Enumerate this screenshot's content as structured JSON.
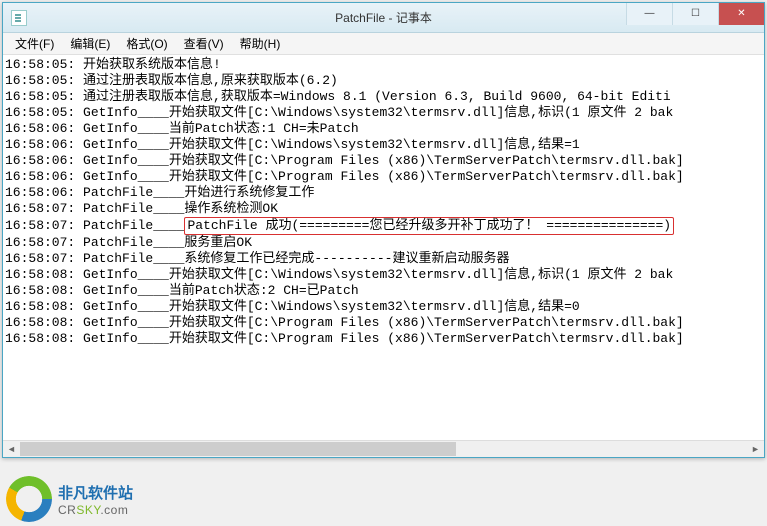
{
  "title": "PatchFile - 记事本",
  "menus": {
    "file": "文件(F)",
    "edit": "编辑(E)",
    "format": "格式(O)",
    "view": "查看(V)",
    "help": "帮助(H)"
  },
  "log_lines": [
    "16:58:05:  开始获取系统版本信息!",
    "16:58:05:  通过注册表取版本信息,原来获取版本(6.2)",
    "16:58:05:  通过注册表取版本信息,获取版本=Windows 8.1 (Version 6.3, Build 9600, 64-bit Editi",
    "16:58:05:  GetInfo____开始获取文件[C:\\Windows\\system32\\termsrv.dll]信息,标识(1 原文件 2 bak",
    "16:58:06:  GetInfo____当前Patch状态:1 CH=未Patch",
    "16:58:06:  GetInfo____开始获取文件[C:\\Windows\\system32\\termsrv.dll]信息,结果=1",
    "16:58:06:  GetInfo____开始获取文件[C:\\Program Files (x86)\\TermServerPatch\\termsrv.dll.bak]",
    "16:58:06:  GetInfo____开始获取文件[C:\\Program Files (x86)\\TermServerPatch\\termsrv.dll.bak]",
    "16:58:06:  PatchFile____开始进行系统修复工作",
    "16:58:07:  PatchFile____操作系统检测OK",
    "16:58:07:  PatchFile____服务重启OK",
    "16:58:07:  PatchFile____系统修复工作已经完成----------建议重新启动服务器",
    "16:58:08:  GetInfo____开始获取文件[C:\\Windows\\system32\\termsrv.dll]信息,标识(1 原文件 2 bak",
    "16:58:08:  GetInfo____当前Patch状态:2 CH=已Patch",
    "16:58:08:  GetInfo____开始获取文件[C:\\Windows\\system32\\termsrv.dll]信息,结果=0",
    "16:58:08:  GetInfo____开始获取文件[C:\\Program Files (x86)\\TermServerPatch\\termsrv.dll.bak]",
    "16:58:08:  GetInfo____开始获取文件[C:\\Program Files (x86)\\TermServerPatch\\termsrv.dll.bak]"
  ],
  "highlight_line": {
    "prefix": "16:58:07:  PatchFile____",
    "boxed": "PatchFile 成功(=========您已经升级多开补丁成功了！ ===============)"
  },
  "highlight_insert_after": 9,
  "footer": {
    "cn": "非凡软件站",
    "en_pre": "CR",
    "en_hi": "SKY",
    "en_post": ".com"
  }
}
